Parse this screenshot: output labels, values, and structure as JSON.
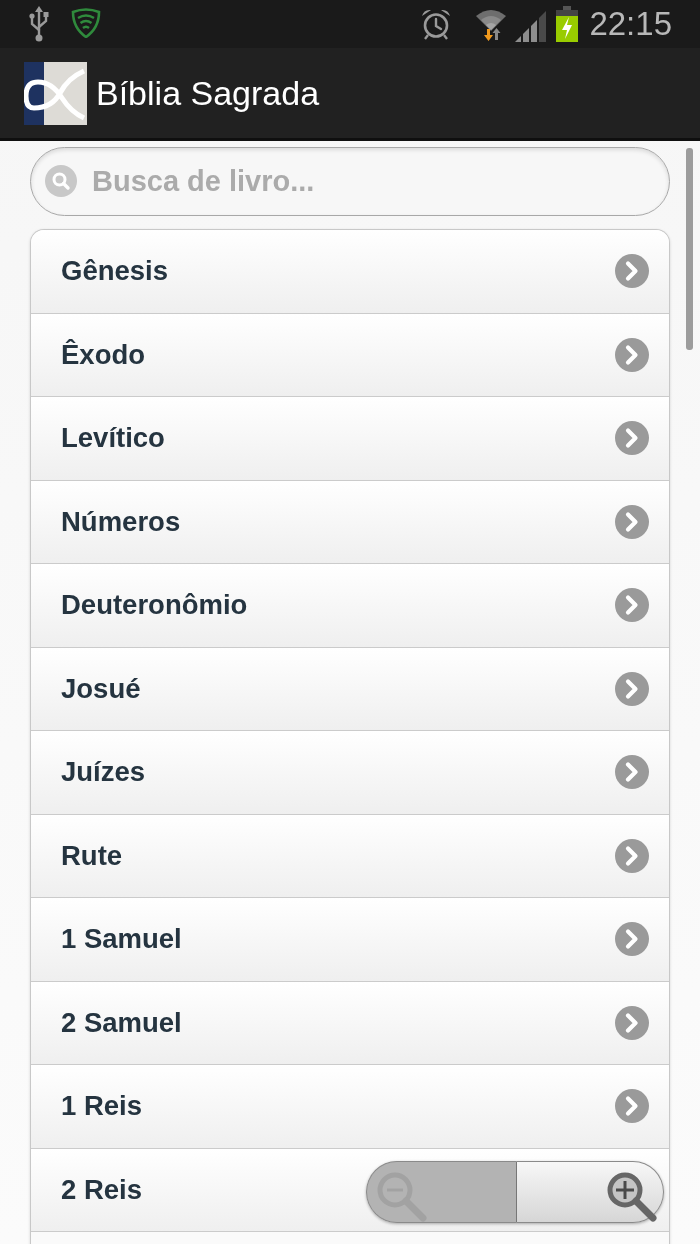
{
  "status_bar": {
    "time": "22:15"
  },
  "action_bar": {
    "title": "Bíblia Sagrada"
  },
  "search": {
    "placeholder": "Busca de livro..."
  },
  "books": [
    {
      "label": "Gênesis"
    },
    {
      "label": "Êxodo"
    },
    {
      "label": "Levítico"
    },
    {
      "label": "Números"
    },
    {
      "label": "Deuteronômio"
    },
    {
      "label": "Josué"
    },
    {
      "label": "Juízes"
    },
    {
      "label": "Rute"
    },
    {
      "label": "1 Samuel"
    },
    {
      "label": "2 Samuel"
    },
    {
      "label": "1 Reis"
    },
    {
      "label": "2 Reis"
    }
  ],
  "zoom_controls": [
    {
      "kind": "zoom-out",
      "disabled": true
    },
    {
      "kind": "zoom-in",
      "disabled": false
    }
  ]
}
